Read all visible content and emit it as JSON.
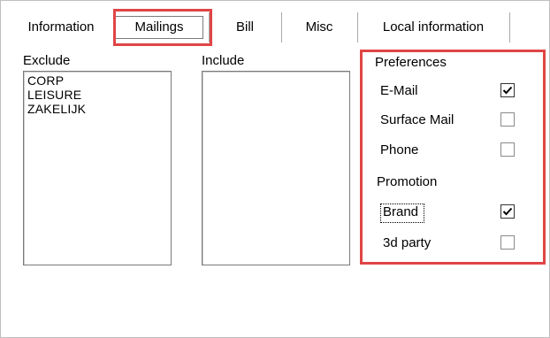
{
  "tabs": [
    {
      "label": "Information",
      "selected": false
    },
    {
      "label": "Mailings",
      "selected": true
    },
    {
      "label": "Bill",
      "selected": false
    },
    {
      "label": "Misc",
      "selected": false
    },
    {
      "label": "Local information",
      "selected": false
    }
  ],
  "exclude": {
    "label": "Exclude",
    "items": [
      "CORP",
      "LEISURE",
      "ZAKELIJK"
    ]
  },
  "include": {
    "label": "Include",
    "items": []
  },
  "preferences": {
    "title": "Preferences",
    "items": [
      {
        "label": "E-Mail",
        "checked": true
      },
      {
        "label": "Surface Mail",
        "checked": false
      },
      {
        "label": "Phone",
        "checked": false
      }
    ]
  },
  "promotion": {
    "title": "Promotion",
    "items": [
      {
        "label": "Brand",
        "checked": true
      },
      {
        "label": "3d party",
        "checked": false
      }
    ]
  },
  "colors": {
    "highlight": "#e04545",
    "border": "#7a7a7a"
  }
}
